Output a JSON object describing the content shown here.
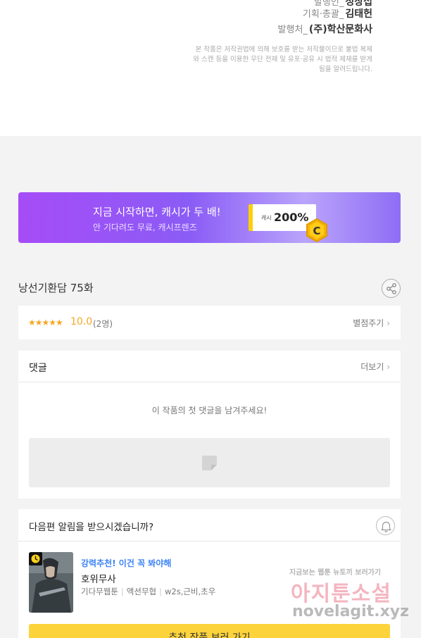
{
  "credits": {
    "lines": [
      {
        "label": "발행인_",
        "value": "정상섭"
      },
      {
        "label": "기획·총괄_",
        "value": "김태헌"
      },
      {
        "label": "발행처_",
        "value": "(주)학산문화사"
      }
    ],
    "notice": "본 작품은 저작권법에 의해 보호를 받는 저작물이므로 불법 복제와 스캔 등을 이용한 무단 전재 및 유포·공유 시 법적 제재를 받게 됨을 알려드립니다."
  },
  "banner": {
    "title": "지금 시작하면, 캐시가 두 배!",
    "subtitle": "안 기다려도 무료, 캐시프렌즈",
    "cash_label": "캐시",
    "cash_value": "200%",
    "coin_letter": "C"
  },
  "episode": {
    "title": "낭선기환담 75화"
  },
  "rating": {
    "stars": "★★★★★",
    "score": "10.0",
    "count": "(2명)",
    "rate_link": "별점주기",
    "chevron": "›"
  },
  "comments": {
    "title": "댓글",
    "more_link": "더보기",
    "chevron": "›",
    "empty_message": "이 작품의 첫 댓글을 남겨주세요!"
  },
  "next_alert": {
    "question": "다음편 알림을 받으시겠습니까?",
    "recommendation": {
      "tag": "강력추천! 이건 꼭 봐야해",
      "name": "호위무사",
      "meta": [
        "기다무웹툰",
        "액션무협",
        "w2s,근비,초우"
      ]
    },
    "button_label": "추천 작품 보러 가기"
  },
  "watermark": {
    "top": "지금보는 웹툰 뉴토끼 보러가기",
    "main": "아지툰소설",
    "url": "novelagit.xyz"
  },
  "icons": {
    "share": "share-icon",
    "bell": "bell-icon",
    "clock": "clock-icon",
    "coin": "coin-icon",
    "comment_placeholder": "image-placeholder-icon"
  },
  "colors": {
    "accent_star": "#f6a623",
    "banner_purple": "#a64cf7",
    "button_yellow": "#fcd33b",
    "reco_blue": "#3b82f6"
  }
}
